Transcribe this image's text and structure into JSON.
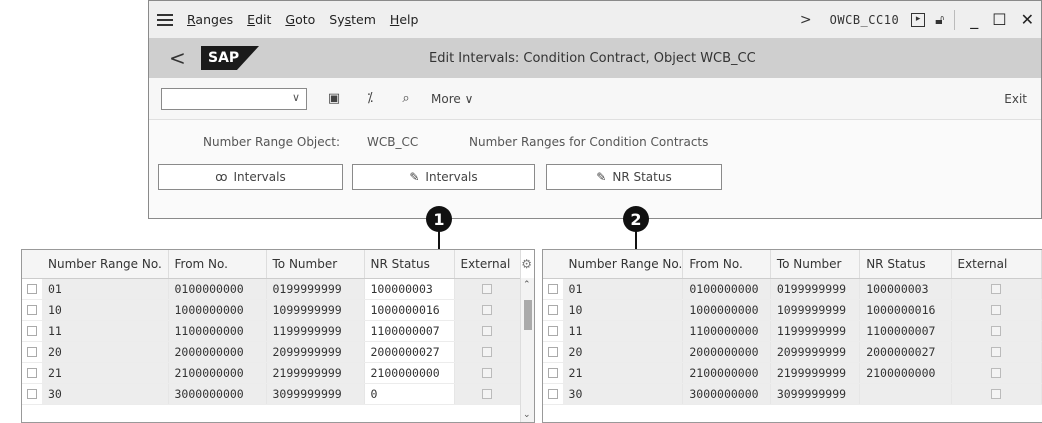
{
  "menu": {
    "items": [
      {
        "first": "R",
        "rest": "anges"
      },
      {
        "first": "E",
        "rest": "dit"
      },
      {
        "first": "G",
        "rest": "oto"
      },
      {
        "first": "Sy",
        "u": "s",
        "rest": "tem"
      },
      {
        "first": "H",
        "rest": "elp"
      }
    ],
    "chevron": ">",
    "tcode": "OWCB_CC10"
  },
  "title": {
    "back": "<",
    "logo": "SAP",
    "text": "Edit Intervals: Condition Contract, Object WCB_CC"
  },
  "toolbar": {
    "command_value": "",
    "more_label": "More",
    "exit_label": "Exit"
  },
  "content": {
    "nro_label": "Number Range Object:",
    "nro_value": "WCB_CC",
    "nro_desc": "Number Ranges for Condition Contracts",
    "btn_display_intervals": "Intervals",
    "btn_change_intervals": "Intervals",
    "btn_nr_status": "NR Status"
  },
  "callouts": [
    "1",
    "2"
  ],
  "table1": {
    "headers": [
      "Number Range No.",
      "From No.",
      "To Number",
      "NR Status",
      "External"
    ],
    "rows": [
      [
        "01",
        "0100000000",
        "0199999999",
        "100000003"
      ],
      [
        "10",
        "1000000000",
        "1099999999",
        "1000000016"
      ],
      [
        "11",
        "1100000000",
        "1199999999",
        "1100000007"
      ],
      [
        "20",
        "2000000000",
        "2099999999",
        "2000000027"
      ],
      [
        "21",
        "2100000000",
        "2199999999",
        "2100000000"
      ],
      [
        "30",
        "3000000000",
        "3099999999",
        "0"
      ]
    ]
  },
  "table2": {
    "headers": [
      "Number Range No.",
      "From No.",
      "To Number",
      "NR Status",
      "External"
    ],
    "rows": [
      [
        "01",
        "0100000000",
        "0199999999",
        "100000003"
      ],
      [
        "10",
        "1000000000",
        "1099999999",
        "1000000016"
      ],
      [
        "11",
        "1100000000",
        "1199999999",
        "1100000007"
      ],
      [
        "20",
        "2000000000",
        "2099999999",
        "2000000027"
      ],
      [
        "21",
        "2100000000",
        "2199999999",
        "2100000000"
      ],
      [
        "30",
        "3000000000",
        "3099999999",
        ""
      ]
    ]
  },
  "icons": {
    "menu": "hamburger-icon",
    "run": "execute-icon",
    "lock": "lock-icon",
    "minimize": "minimize-icon",
    "maximize": "maximize-icon",
    "close": "close-icon",
    "image": "image-icon",
    "magic": "wand-icon",
    "find": "find-icon",
    "glasses": "display-icon",
    "pencil": "pencil-icon",
    "settings": "settings-icon"
  }
}
